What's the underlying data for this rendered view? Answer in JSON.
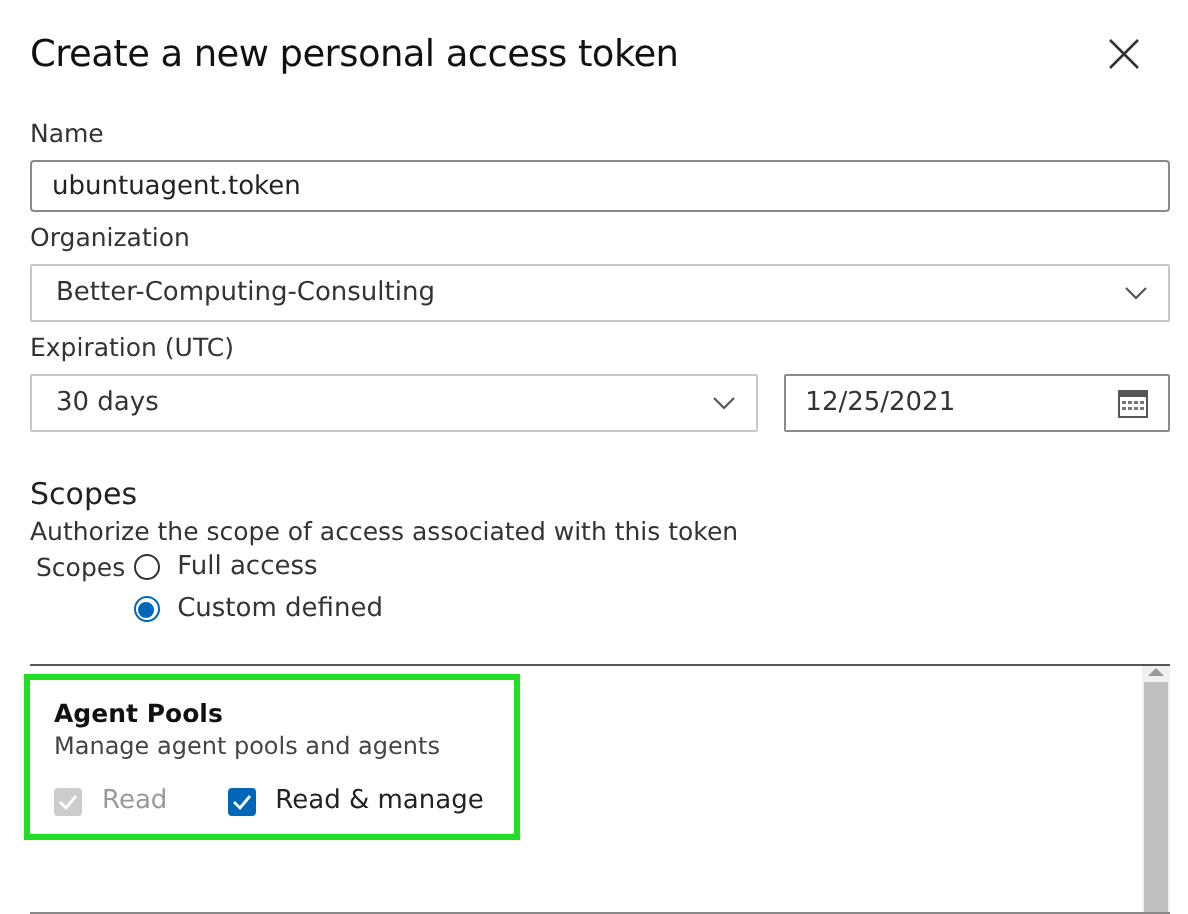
{
  "dialog": {
    "title": "Create a new personal access token"
  },
  "fields": {
    "name": {
      "label": "Name",
      "value": "ubuntuagent.token"
    },
    "organization": {
      "label": "Organization",
      "value": "Better-Computing-Consulting"
    },
    "expiration": {
      "label": "Expiration (UTC)",
      "value": "30 days",
      "date": "12/25/2021"
    }
  },
  "scopes": {
    "heading": "Scopes",
    "description": "Authorize the scope of access associated with this token",
    "group_label": "Scopes",
    "options": [
      {
        "label": "Full access",
        "selected": false
      },
      {
        "label": "Custom defined",
        "selected": true
      }
    ]
  },
  "scope_list": {
    "items": [
      {
        "title": "Agent Pools",
        "description": "Manage agent pools and agents",
        "highlighted": true,
        "permissions": [
          {
            "label": "Read",
            "checked": true,
            "disabled": true
          },
          {
            "label": "Read & manage",
            "checked": true,
            "disabled": false
          }
        ]
      }
    ]
  }
}
